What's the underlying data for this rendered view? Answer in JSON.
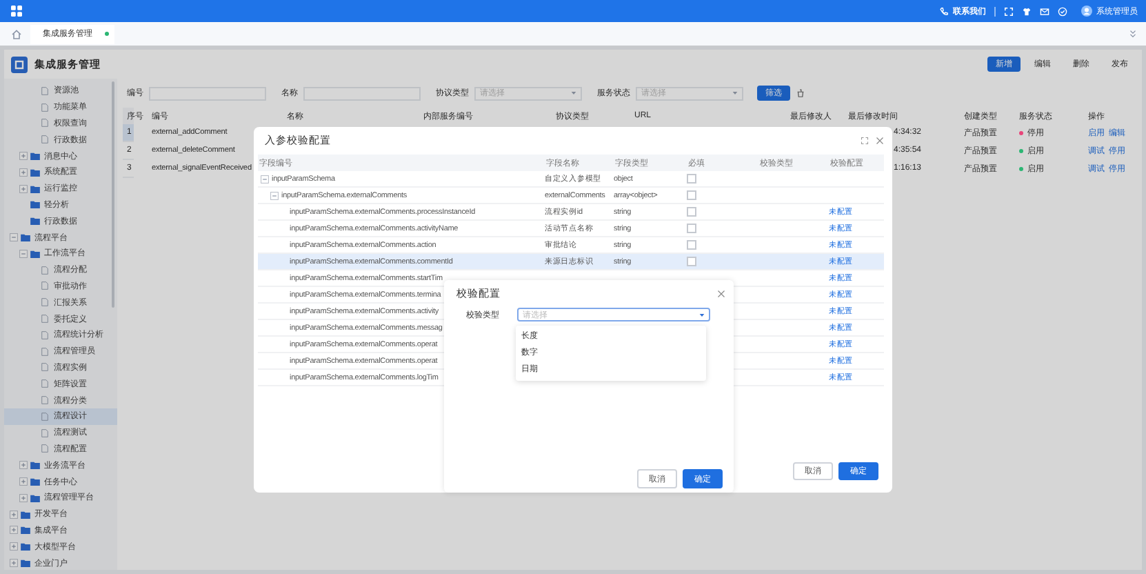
{
  "topbar": {
    "contact": "联系我们",
    "user": "系统管理员"
  },
  "tabs": [
    {
      "label": "集成服务管理",
      "selected": true
    }
  ],
  "page": {
    "title": "集成服务管理",
    "actions": [
      {
        "label": "新增",
        "primary": true
      },
      {
        "label": "编辑",
        "primary": false
      },
      {
        "label": "删除",
        "primary": false
      },
      {
        "label": "发布",
        "primary": false
      }
    ]
  },
  "sidebar": {
    "items": [
      {
        "kind": "hidden",
        "children": [
          {
            "kind": "hidden",
            "children": [
              {
                "kind": "page",
                "label": "资源池",
                "selected": false
              },
              {
                "kind": "page",
                "label": "功能菜单",
                "selected": false
              },
              {
                "kind": "page",
                "label": "权限查询",
                "selected": false
              },
              {
                "kind": "page",
                "label": "行政数据",
                "selected": false
              }
            ]
          },
          {
            "kind": "folder",
            "label": "消息中心",
            "expanded": false,
            "selected": false
          },
          {
            "kind": "folder",
            "label": "系统配置",
            "expanded": false,
            "selected": false
          },
          {
            "kind": "folder",
            "label": "运行监控",
            "expanded": false,
            "selected": false
          },
          {
            "kind": "folder",
            "label": "轻分析",
            "selected": false
          },
          {
            "kind": "folder",
            "label": "行政数据",
            "selected": false
          }
        ]
      },
      {
        "kind": "folder",
        "label": "流程平台",
        "expanded": true,
        "selected": false,
        "children": [
          {
            "kind": "folder",
            "label": "工作流平台",
            "expanded": true,
            "selected": false,
            "children": [
              {
                "kind": "page",
                "label": "流程分配",
                "selected": false
              },
              {
                "kind": "page",
                "label": "审批动作",
                "selected": false
              },
              {
                "kind": "page",
                "label": "汇报关系",
                "selected": false
              },
              {
                "kind": "page",
                "label": "委托定义",
                "selected": false
              },
              {
                "kind": "page",
                "label": "流程统计分析",
                "selected": false
              },
              {
                "kind": "page",
                "label": "流程管理员",
                "selected": false
              },
              {
                "kind": "page",
                "label": "流程实例",
                "selected": false
              },
              {
                "kind": "page",
                "label": "矩阵设置",
                "selected": false
              },
              {
                "kind": "page",
                "label": "流程分类",
                "selected": false
              },
              {
                "kind": "page",
                "label": "流程设计",
                "selected": true
              },
              {
                "kind": "page",
                "label": "流程测试",
                "selected": false
              },
              {
                "kind": "page",
                "label": "流程配置",
                "selected": false
              }
            ]
          },
          {
            "kind": "folder",
            "label": "业务流平台",
            "expanded": false,
            "selected": false
          },
          {
            "kind": "folder",
            "label": "任务中心",
            "expanded": false,
            "selected": false
          },
          {
            "kind": "folder",
            "label": "流程管理平台",
            "expanded": false,
            "selected": false
          }
        ]
      },
      {
        "kind": "folder",
        "label": "开发平台",
        "expanded": false,
        "selected": false
      },
      {
        "kind": "folder",
        "label": "集成平台",
        "expanded": false,
        "selected": false
      },
      {
        "kind": "folder",
        "label": "大模型平台",
        "expanded": false,
        "selected": false
      },
      {
        "kind": "folder",
        "label": "企业门户",
        "expanded": false,
        "selected": false
      }
    ]
  },
  "filters": [
    {
      "kind": "input",
      "label": "编号"
    },
    {
      "kind": "input",
      "label": "名称"
    },
    {
      "kind": "select",
      "label": "协议类型",
      "placeholder": "请选择"
    },
    {
      "kind": "select",
      "label": "服务状态",
      "placeholder": "请选择"
    }
  ],
  "filter_button": "筛选",
  "table": {
    "columns": [
      "序号",
      "编号",
      "名称",
      "内部服务编号",
      "协议类型",
      "URL",
      "最后修改人",
      "最后修改时间",
      "创建类型",
      "服务状态",
      "操作"
    ],
    "rows": [
      {
        "index": "1",
        "code": "external_addComment",
        "modified_time": "4:34:32",
        "create_type": "产品预置",
        "status": "停用",
        "color": "#e8457a",
        "actions": [
          "启用",
          "编辑"
        ],
        "selected": true
      },
      {
        "index": "2",
        "code": "external_deleteComment",
        "modified_time": "4:35:54",
        "create_type": "产品预置",
        "status": "启用",
        "color": "#2bb673",
        "actions": [
          "调试",
          "停用"
        ],
        "selected": false
      },
      {
        "index": "3",
        "code": "external_signalEventReceived",
        "modified_time": "1:16:13",
        "create_type": "产品预置",
        "status": "启用",
        "color": "#2bb673",
        "actions": [
          "调试",
          "停用"
        ],
        "selected": false
      }
    ]
  },
  "param_dialog": {
    "title": "入参校验配置",
    "columns": [
      "字段编号",
      "字段名称",
      "字段类型",
      "必填",
      "校验类型",
      "校验配置"
    ],
    "params": [
      {
        "code": "inputParamSchema",
        "name": "自定义入参模型",
        "type": "object",
        "required": false,
        "expanded": true,
        "selected": false,
        "children": [
          {
            "code": "inputParamSchema.externalComments",
            "name": "externalComments",
            "type": "array<object>",
            "required": false,
            "expanded": true,
            "selected": false,
            "children": [
              {
                "code": "inputParamSchema.externalComments.processInstanceId",
                "name": "流程实例id",
                "type": "string",
                "required": false,
                "config": "未配置",
                "selected": false
              },
              {
                "code": "inputParamSchema.externalComments.activityName",
                "name": "活动节点名称",
                "type": "string",
                "required": false,
                "config": "未配置",
                "selected": false
              },
              {
                "code": "inputParamSchema.externalComments.action",
                "name": "审批结论",
                "type": "string",
                "required": false,
                "config": "未配置",
                "selected": false
              },
              {
                "code": "inputParamSchema.externalComments.commentId",
                "name": "来源日志标识",
                "type": "string",
                "required": false,
                "config": "未配置",
                "selected": true
              },
              {
                "code": "inputParamSchema.externalComments.startTim",
                "config": "未配置",
                "selected": false
              },
              {
                "code": "inputParamSchema.externalComments.termina",
                "config": "未配置",
                "selected": false
              },
              {
                "code": "inputParamSchema.externalComments.activity",
                "config": "未配置",
                "selected": false
              },
              {
                "code": "inputParamSchema.externalComments.messag",
                "config": "未配置",
                "selected": false
              },
              {
                "code": "inputParamSchema.externalComments.operat",
                "config": "未配置",
                "selected": false
              },
              {
                "code": "inputParamSchema.externalComments.operat",
                "config": "未配置",
                "selected": false
              },
              {
                "code": "inputParamSchema.externalComments.logTim",
                "config": "未配置",
                "selected": false
              }
            ]
          }
        ]
      }
    ],
    "buttons": [
      {
        "label": "取消",
        "primary": false
      },
      {
        "label": "确定",
        "primary": true
      }
    ]
  },
  "validation_dialog": {
    "title": "校验配置",
    "field_label": "校验类型",
    "placeholder": "请选择",
    "options": [
      "长度",
      "数字",
      "日期"
    ],
    "buttons": [
      {
        "label": "取消",
        "primary": false
      },
      {
        "label": "确定",
        "primary": true
      }
    ]
  }
}
